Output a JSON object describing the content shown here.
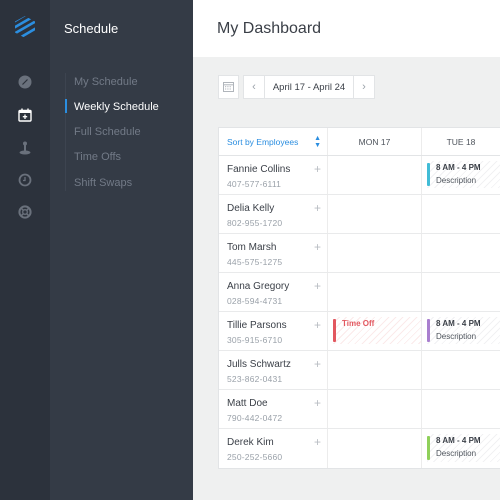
{
  "app": {
    "brand_color": "#2b8ee0",
    "logo_icon": "striped-hexagon-logo"
  },
  "rail": {
    "icons": [
      {
        "name": "compass-icon",
        "active": false
      },
      {
        "name": "calendar-add-icon",
        "active": true
      },
      {
        "name": "joystick-icon",
        "active": false
      },
      {
        "name": "clock-icon",
        "active": false
      },
      {
        "name": "lifebuoy-icon",
        "active": false
      }
    ]
  },
  "subnav": {
    "title": "Schedule",
    "items": [
      {
        "label": "My Schedule",
        "active": false
      },
      {
        "label": "Weekly Schedule",
        "active": true
      },
      {
        "label": "Full Schedule",
        "active": false
      },
      {
        "label": "Time Offs",
        "active": false
      },
      {
        "label": "Shift Swaps",
        "active": false
      }
    ]
  },
  "header": {
    "title": "My Dashboard"
  },
  "toolbar": {
    "calendar_icon": "calendar-icon",
    "prev_label": "‹",
    "date_range": "April 17 - April 24",
    "next_label": "›"
  },
  "table": {
    "sort_label": "Sort by Employees",
    "sort_icon": "⇕",
    "days": [
      "MON 17",
      "TUE 18"
    ],
    "add_label": "+",
    "rows": [
      {
        "name": "Fannie Collins",
        "phone": "407-577-6111",
        "mon": null,
        "tue": {
          "type": "shift",
          "time": "8 AM - 4 PM",
          "desc": "Description",
          "color": "#41bcd6"
        }
      },
      {
        "name": "Delia Kelly",
        "phone": "802-955-1720",
        "mon": null,
        "tue": null
      },
      {
        "name": "Tom Marsh",
        "phone": "445-575-1275",
        "mon": null,
        "tue": null
      },
      {
        "name": "Anna Gregory",
        "phone": "028-594-4731",
        "mon": null,
        "tue": null
      },
      {
        "name": "Tillie Parsons",
        "phone": "305-915-6710",
        "mon": {
          "type": "timeoff",
          "time": "Time Off",
          "desc": "",
          "color": "#e2575f"
        },
        "tue": {
          "type": "shift",
          "time": "8 AM - 4 PM",
          "desc": "Description",
          "color": "#a97fcf"
        }
      },
      {
        "name": "Julls Schwartz",
        "phone": "523-862-0431",
        "mon": null,
        "tue": null
      },
      {
        "name": "Matt Doe",
        "phone": "790-442-0472",
        "mon": null,
        "tue": null
      },
      {
        "name": "Derek Kim",
        "phone": "250-252-5660",
        "mon": null,
        "tue": {
          "type": "shift",
          "time": "8 AM - 4 PM",
          "desc": "Description",
          "color": "#8fd05a"
        }
      }
    ]
  }
}
